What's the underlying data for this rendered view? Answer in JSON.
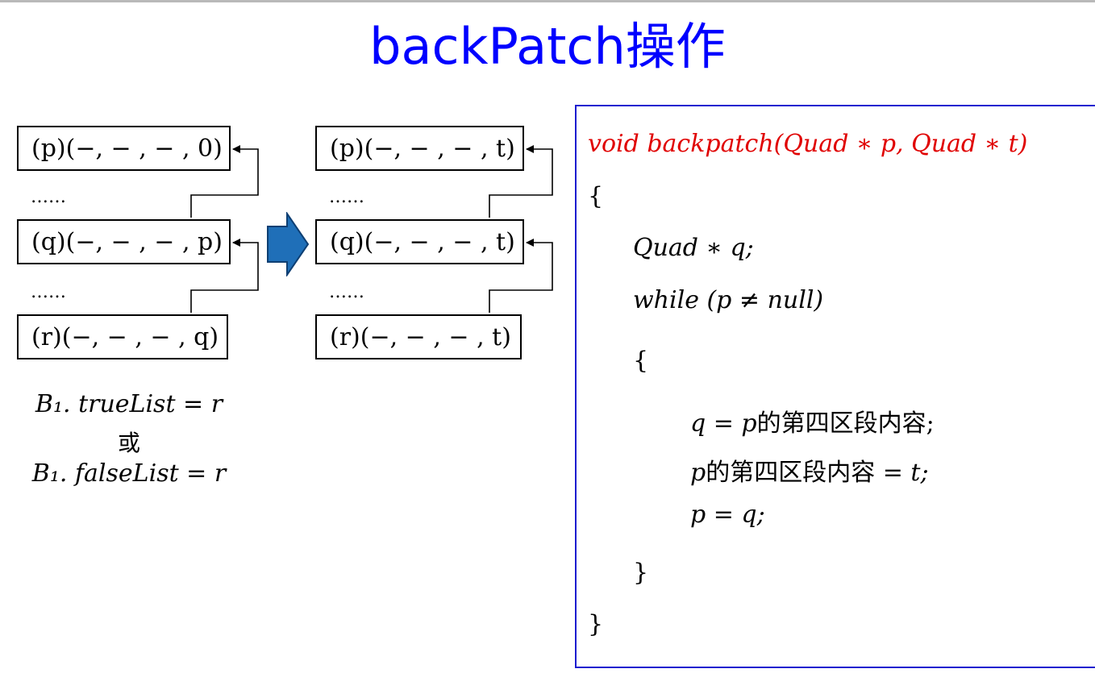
{
  "title": "backPatch操作",
  "before": {
    "quad_p": "(p)(−, − , − , 0)",
    "quad_q": "(q)(−, − , − , p)",
    "quad_r": "(r)(−, − , − , q)",
    "ellipsis_1": "……",
    "ellipsis_2": "……"
  },
  "after": {
    "quad_p": "(p)(−, − , − , t)",
    "quad_q": "(q)(−, − , − , t)",
    "quad_r": "(r)(−, − , − , t)",
    "ellipsis_1": "……",
    "ellipsis_2": "……"
  },
  "conditions": {
    "true_list": "B₁. trueList = r",
    "or": "或",
    "false_list": "B₁. falseList = r"
  },
  "code": {
    "signature": "void backpatch(Quad  ∗ p, Quad  ∗ t)",
    "open_brace_outer": "{",
    "decl": "Quad ∗ q;",
    "while": "while (p ≠ null)",
    "open_brace_inner": "{",
    "stmt1_lhs": "q = p",
    "stmt1_cn": "的第四区段内容",
    "stmt1_end": ";",
    "stmt2_var": "p",
    "stmt2_cn": "的第四区段内容",
    "stmt2_rhs": " = t;",
    "stmt3": "p = q;",
    "close_brace_inner": "}",
    "close_brace_outer": "}"
  },
  "colors": {
    "title": "#0000ff",
    "signature": "#e00000",
    "code_border": "#1c1ccf",
    "transform_arrow": "#1f6fb8"
  }
}
